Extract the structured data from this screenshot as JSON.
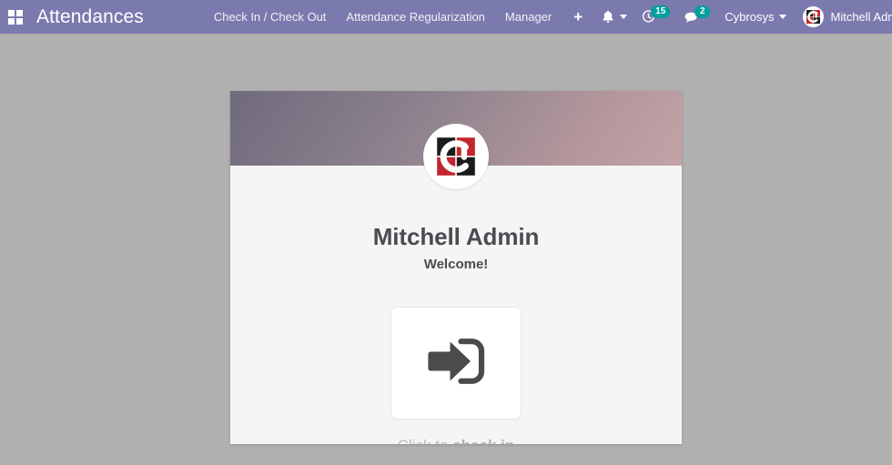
{
  "navbar": {
    "apps_icon": "apps-grid-icon",
    "brand": "Attendances",
    "menu": [
      {
        "label": "Check In / Check Out",
        "name": "menu-check-in-check-out"
      },
      {
        "label": "Attendance Regularization",
        "name": "menu-attendance-regularization"
      },
      {
        "label": "Manager",
        "name": "menu-manager"
      }
    ],
    "plus_label": "+",
    "systray": {
      "bell_icon": "bell-icon",
      "activities_icon": "clock-activity-icon",
      "activities_count": "15",
      "messages_icon": "speech-bubble-icon",
      "messages_count": "2",
      "company": "Cybrosys",
      "user_name": "Mitchell Admin",
      "avatar_icon": "cybrosys-logo-icon"
    }
  },
  "card": {
    "avatar_icon": "cybrosys-logo-icon",
    "person_name": "Mitchell Admin",
    "welcome": "Welcome!",
    "checkin_icon": "sign-in-arrow-icon",
    "caption_prefix": "Click to ",
    "caption_action": "check in"
  },
  "colors": {
    "navbar": "#7b7aae",
    "page_background": "#b0b0b0",
    "card_background": "#f5f5f5",
    "badge": "#00a09d",
    "heading_text": "#4b4b52",
    "caption_text": "#b9bcc6",
    "logo_red": "#c3262e",
    "logo_dark": "#1c1c1c"
  }
}
